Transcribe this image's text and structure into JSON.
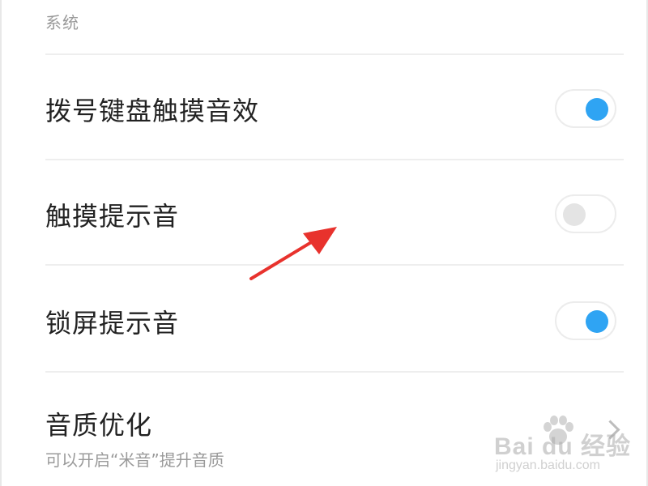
{
  "section": {
    "title": "系统"
  },
  "settings": {
    "items": [
      {
        "label": "拨号键盘触摸音效",
        "state": "on"
      },
      {
        "label": "触摸提示音",
        "state": "off"
      },
      {
        "label": "锁屏提示音",
        "state": "on"
      },
      {
        "label": "音质优化",
        "sublabel": "可以开启“米音”提升音质"
      }
    ]
  },
  "colors": {
    "toggle_on": "#2fa4f3",
    "toggle_off": "#e4e4e4",
    "annotation_arrow": "#e8322d"
  },
  "watermark": {
    "logo": "Bai du 经验",
    "url": "jingyan.baidu.com"
  }
}
